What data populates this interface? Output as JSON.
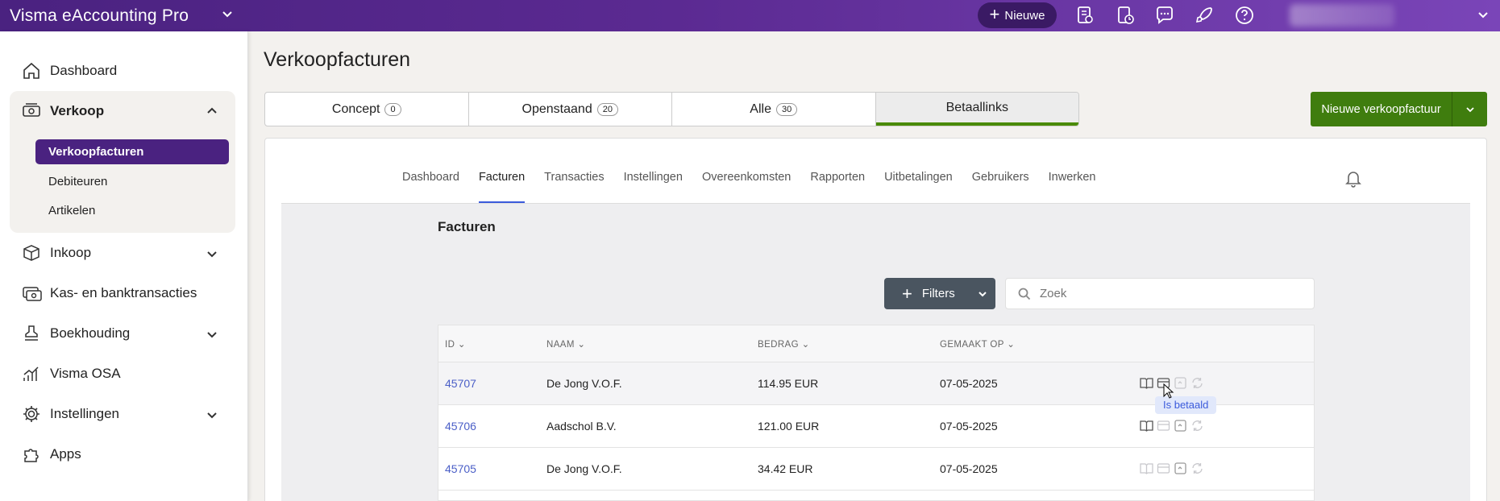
{
  "topbar": {
    "app_title": "Visma eAccounting Pro",
    "new_label": "Nieuwe",
    "icons": [
      "invoice-icon",
      "time-icon",
      "chat-icon",
      "rocket-icon",
      "help-icon"
    ]
  },
  "sidebar": {
    "items": [
      {
        "label": "Dashboard",
        "icon": "home-icon"
      },
      {
        "label": "Verkoop",
        "icon": "cash-icon"
      },
      {
        "label": "Inkoop",
        "icon": "box-icon"
      },
      {
        "label": "Kas- en banktransacties",
        "icon": "bank-icon"
      },
      {
        "label": "Boekhouding",
        "icon": "stamp-icon"
      },
      {
        "label": "Visma OSA",
        "icon": "chart-icon"
      },
      {
        "label": "Instellingen",
        "icon": "gear-icon"
      },
      {
        "label": "Apps",
        "icon": "puzzle-icon"
      }
    ],
    "verkoop_sub": [
      "Verkoopfacturen",
      "Debiteuren",
      "Artikelen"
    ]
  },
  "main": {
    "page_title": "Verkoopfacturen",
    "tabs": [
      {
        "label": "Concept",
        "count": "0"
      },
      {
        "label": "Openstaand",
        "count": "20"
      },
      {
        "label": "Alle",
        "count": "30"
      },
      {
        "label": "Betaallinks",
        "count": ""
      }
    ],
    "new_invoice_label": "Nieuwe verkoopfactuur"
  },
  "panel": {
    "subnav": [
      "Dashboard",
      "Facturen",
      "Transacties",
      "Instellingen",
      "Overeenkomsten",
      "Rapporten",
      "Uitbetalingen",
      "Gebruikers",
      "Inwerken"
    ],
    "section_title": "Facturen",
    "filters_label": "Filters",
    "search_placeholder": "Zoek",
    "columns": [
      "ID",
      "NAAM",
      "BEDRAG",
      "GEMAAKT OP"
    ],
    "rows": [
      {
        "id": "45707",
        "name": "De Jong V.O.F.",
        "amount": "114.95 EUR",
        "date": "07-05-2025"
      },
      {
        "id": "45706",
        "name": "Aadschol B.V.",
        "amount": "121.00 EUR",
        "date": "07-05-2025"
      },
      {
        "id": "45705",
        "name": "De Jong V.O.F.",
        "amount": "34.42 EUR",
        "date": "07-05-2025"
      }
    ],
    "tooltip": "Is betaald"
  },
  "colors": {
    "brand": "#4a2280",
    "accent_green": "#3f7d0e",
    "link": "#4b5fc7"
  }
}
